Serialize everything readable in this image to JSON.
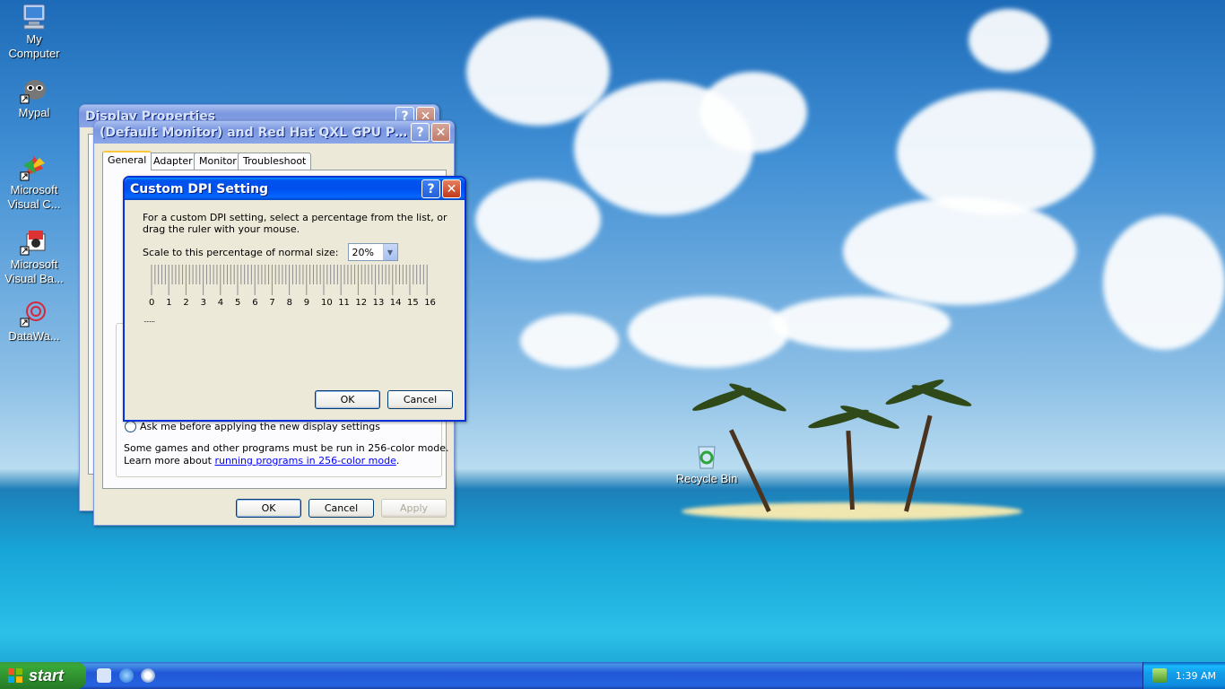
{
  "desktop": {
    "icons": [
      {
        "label_line1": "My",
        "label_line2": "Computer",
        "icon": "my-computer-icon"
      },
      {
        "label_line1": "Mypal",
        "label_line2": "",
        "icon": "mypal-icon"
      },
      {
        "label_line1": "Microsoft",
        "label_line2": "Visual C...",
        "icon": "visual-c-icon"
      },
      {
        "label_line1": "Microsoft",
        "label_line2": "Visual Ba...",
        "icon": "visual-basic-icon"
      },
      {
        "label_line1": "DataWa...",
        "label_line2": "",
        "icon": "datawa-icon"
      },
      {
        "label_line1": "Recycle Bin",
        "label_line2": "",
        "icon": "recycle-bin-icon"
      }
    ]
  },
  "display_properties": {
    "title": "Display Properties"
  },
  "monitor_props": {
    "title": "(Default Monitor) and Red Hat QXL GPU Pro...",
    "tabs": [
      "General",
      "Adapter",
      "Monitor",
      "Troubleshoot"
    ],
    "radio_label": "Ask me before applying the new display settings",
    "info_line1": "Some games and other programs must be run in 256-color mode.",
    "info_line2_prefix": "Learn more about ",
    "info_link": "running programs in 256-color mode",
    "info_line2_suffix": ".",
    "ok_label": "OK",
    "cancel_label": "Cancel",
    "apply_label": "Apply"
  },
  "custom_dpi": {
    "title": "Custom DPI Setting",
    "instructions_line1": "For a custom DPI setting, select a percentage from the list, or",
    "instructions_line2": "drag the ruler with your mouse.",
    "scale_label": "Scale to this percentage of normal size:",
    "scale_value": "20%",
    "ruler_numbers": [
      "0",
      "1",
      "2",
      "3",
      "4",
      "5",
      "6",
      "7",
      "8",
      "9",
      "10",
      "11",
      "12",
      "13",
      "14",
      "15",
      "16"
    ],
    "sample_text": "........",
    "ok_label": "OK",
    "cancel_label": "Cancel"
  },
  "taskbar": {
    "start_label": "start",
    "clock": "1:39 AM",
    "quick_launch": [
      "show-desktop-icon",
      "ie-icon",
      "media-player-icon"
    ]
  },
  "colors": {
    "titlebar_active": "#0053ee",
    "dialog_face": "#ece9d8",
    "link": "#0000ff"
  }
}
